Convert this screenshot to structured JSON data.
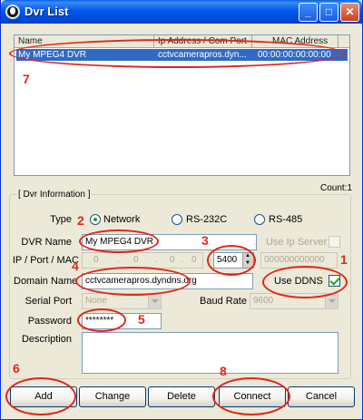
{
  "window": {
    "title": "Dvr List"
  },
  "titlebar_buttons": {
    "minimize": "_",
    "maximize": "□",
    "close": "✕"
  },
  "list": {
    "columns": [
      "Name",
      "Ip Address / Com Port",
      "MAC Address"
    ],
    "rows": [
      {
        "name": "My MPEG4 DVR",
        "ip": "cctvcamerapros.dyn...",
        "mac": "00:00:00:00:00:00"
      }
    ]
  },
  "count_label": "Count:1",
  "group": {
    "title": "[ Dvr Information ]"
  },
  "type": {
    "label": "Type",
    "options": [
      "Network",
      "RS-232C",
      "RS-485"
    ],
    "selected": "Network"
  },
  "dvr_name": {
    "label": "DVR Name",
    "value": "My MPEG4 DVR"
  },
  "use_ip_server": {
    "label": "Use Ip Server",
    "checked": false
  },
  "ip_port_mac": {
    "label": "IP / Port / MAC",
    "ip_octets": [
      "0",
      ".",
      "0",
      ".",
      "0",
      ".",
      "0"
    ],
    "port": "5400",
    "mac_placeholder": "000000000000"
  },
  "domain_name": {
    "label": "Domain Name",
    "value": "cctvcamerapros.dyndns.org"
  },
  "use_ddns": {
    "label": "Use DDNS",
    "checked": true
  },
  "serial_port": {
    "label": "Serial Port",
    "value": "None"
  },
  "baud_rate": {
    "label": "Baud Rate",
    "value": "9600"
  },
  "password": {
    "label": "Password",
    "value": "********"
  },
  "description": {
    "label": "Description",
    "value": ""
  },
  "buttons": {
    "add": "Add",
    "change": "Change",
    "delete": "Delete",
    "connect": "Connect",
    "cancel": "Cancel"
  },
  "annotations": [
    "1",
    "2",
    "3",
    "4",
    "5",
    "6",
    "7",
    "8"
  ],
  "colors": {
    "annotation": "#e0271a",
    "selection": "#316ac5",
    "titlebar": "#0058ee"
  }
}
